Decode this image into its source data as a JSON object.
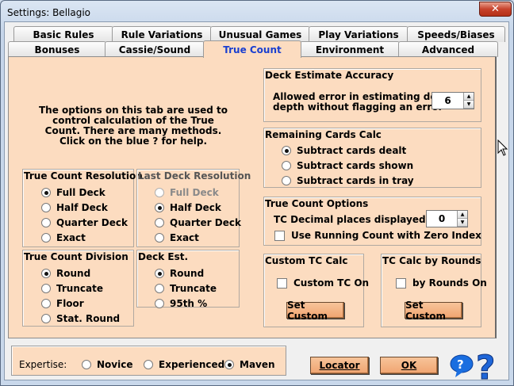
{
  "window": {
    "title": "Settings: Bellagio",
    "close_label": "✕"
  },
  "tabs_row1": [
    "Basic Rules",
    "Rule Variations",
    "Unusual Games",
    "Play Variations",
    "Speeds/Biases"
  ],
  "tabs_row2": [
    "Bonuses",
    "Cassie/Sound",
    "True Count",
    "Environment",
    "Advanced"
  ],
  "intro_text": "The options on this tab are used to control calculation of the True Count. There are many methods. Click on the blue ? for help.",
  "tc_resolution": {
    "title": "True Count Resolution",
    "options": [
      "Full Deck",
      "Half Deck",
      "Quarter Deck",
      "Exact"
    ],
    "selected": "Full Deck"
  },
  "last_deck_resolution": {
    "title": "Last Deck Resolution",
    "options": [
      "Full Deck",
      "Half Deck",
      "Quarter Deck",
      "Exact"
    ],
    "selected": "Half Deck"
  },
  "tc_division": {
    "title": "True Count Division",
    "options": [
      "Round",
      "Truncate",
      "Floor",
      "Stat. Round"
    ],
    "selected": "Round"
  },
  "deck_est": {
    "title": "Deck Est.",
    "options": [
      "Round",
      "Truncate",
      "95th %"
    ],
    "selected": "Round"
  },
  "deck_estimate_accuracy": {
    "title": "Deck Estimate Accuracy",
    "label_line1": "Allowed error in estimating deck",
    "label_line2": "depth without flagging an error",
    "value": "6"
  },
  "remaining_cards": {
    "title": "Remaining Cards Calc",
    "options": [
      "Subtract cards dealt",
      "Subtract cards shown",
      "Subtract cards in tray"
    ],
    "selected": "Subtract cards dealt"
  },
  "tc_options": {
    "title": "True Count Options",
    "decimal_label": "TC Decimal places displayed",
    "decimal_value": "0",
    "running_count_label": "Use Running Count with Zero Index"
  },
  "custom_tc": {
    "title": "Custom TC Calc",
    "checkbox_label": "Custom TC On",
    "button_label": "Set Custom"
  },
  "tc_by_rounds": {
    "title": "TC Calc by Rounds",
    "checkbox_label": "by Rounds On",
    "button_label": "Set Custom"
  },
  "expertise": {
    "label": "Expertise:",
    "options": [
      "Novice",
      "Experienced",
      "Maven"
    ],
    "selected": "Maven"
  },
  "buttons": {
    "locator": "Locator",
    "ok": "OK"
  },
  "colors": {
    "panel": "#fcdcc0",
    "button": "#f0a470",
    "active_tab_text": "#1a3fd0",
    "help_icon": "#1a6ee0"
  }
}
